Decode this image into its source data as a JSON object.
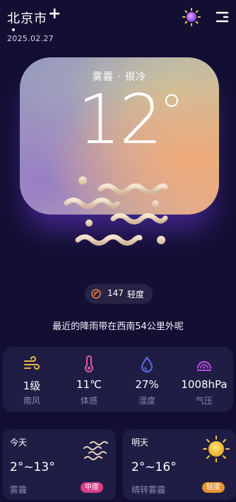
{
  "header": {
    "city": "北京市",
    "add_symbol": "+",
    "date": "2025.02.27"
  },
  "main": {
    "condition": "雾霾 · 很冷",
    "temperature": "12"
  },
  "aqi": {
    "value": "147",
    "level": "轻度"
  },
  "rain_message": "最近的降雨带在西南54公里外呢",
  "stats": [
    {
      "value": "1级",
      "label": "南风",
      "icon": "wind-icon",
      "color": "#e8b54a"
    },
    {
      "value": "11℃",
      "label": "体感",
      "icon": "thermometer-icon",
      "color": "#e05aa8"
    },
    {
      "value": "27%",
      "label": "湿度",
      "icon": "droplet-icon",
      "color": "#5d6cf0"
    },
    {
      "value": "1008hPa",
      "label": "气压",
      "icon": "gauge-icon",
      "color": "#b24ad6"
    }
  ],
  "forecast": [
    {
      "title": "今天",
      "temp": "2°~13°",
      "condition": "雾霾",
      "badge": "中度",
      "badge_color": "#d83f86",
      "icon": "haze-icon"
    },
    {
      "title": "明天",
      "temp": "2°~16°",
      "condition": "晴转雾霾",
      "badge": "轻度",
      "badge_color": "#e6922f",
      "icon": "sun-icon"
    }
  ],
  "colors": {
    "background": "#130f33",
    "card_background": "#201d44",
    "aqi_icon": "#e7793a"
  }
}
